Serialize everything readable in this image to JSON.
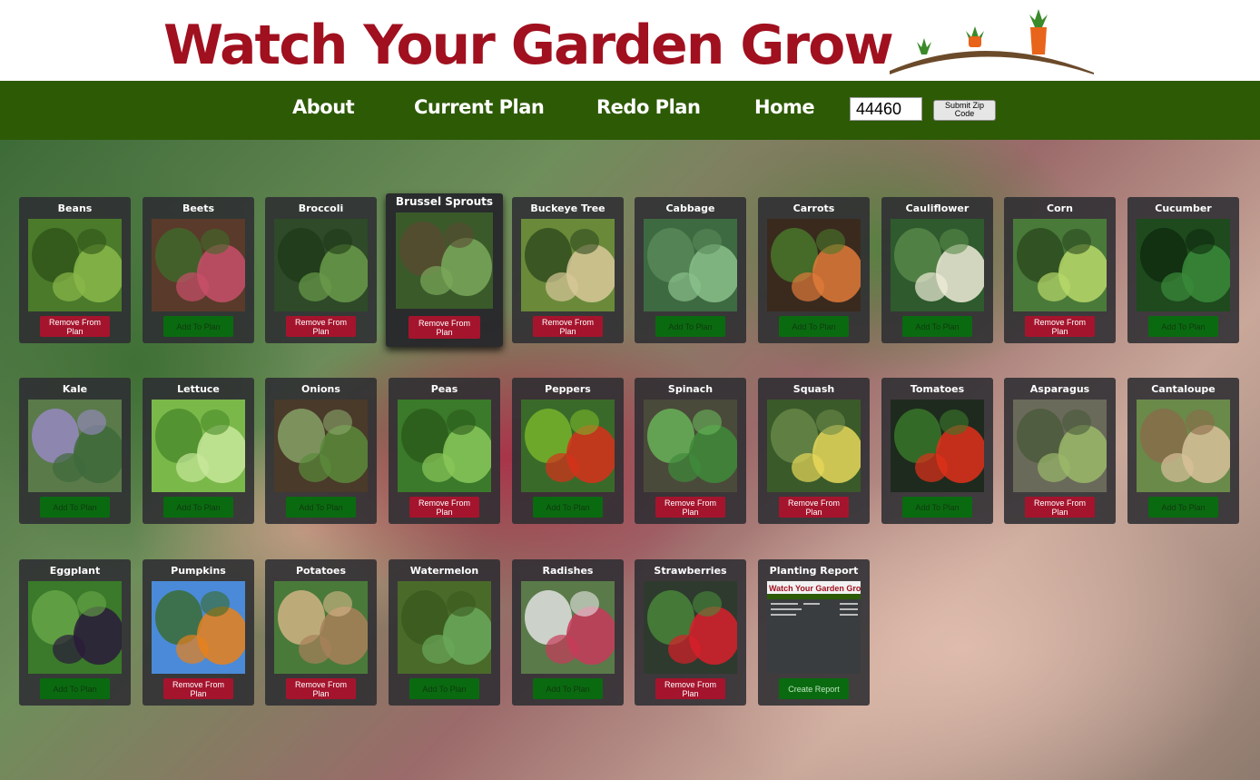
{
  "header": {
    "logo_text": "Watch Your Garden Grow"
  },
  "nav": {
    "links": [
      "About",
      "Current Plan",
      "Redo Plan",
      "Home"
    ],
    "zip_value": "44460",
    "zip_button": "Submit Zip Code"
  },
  "colors": {
    "brand_red": "#a0101f",
    "nav_green": "#2d5a05",
    "add_green": "#0a6a10",
    "remove_red": "#a5142d"
  },
  "cards": [
    {
      "name": "Beans",
      "button": "Remove From Plan",
      "state": "remove"
    },
    {
      "name": "Beets",
      "button": "Add To Plan",
      "state": "add"
    },
    {
      "name": "Broccoli",
      "button": "Remove From Plan",
      "state": "remove"
    },
    {
      "name": "Brussel Sprouts",
      "button": "Remove From Plan",
      "state": "remove"
    },
    {
      "name": "Buckeye Tree",
      "button": "Remove From Plan",
      "state": "remove"
    },
    {
      "name": "Cabbage",
      "button": "Add To Plan",
      "state": "add"
    },
    {
      "name": "Carrots",
      "button": "Add To Plan",
      "state": "add"
    },
    {
      "name": "Cauliflower",
      "button": "Add To Plan",
      "state": "add"
    },
    {
      "name": "Corn",
      "button": "Remove From Plan",
      "state": "remove"
    },
    {
      "name": "Cucumber",
      "button": "Add To Plan",
      "state": "add"
    },
    {
      "name": "Kale",
      "button": "Add To Plan",
      "state": "add"
    },
    {
      "name": "Lettuce",
      "button": "Add To Plan",
      "state": "add"
    },
    {
      "name": "Onions",
      "button": "Add To Plan",
      "state": "add"
    },
    {
      "name": "Peas",
      "button": "Remove From Plan",
      "state": "remove"
    },
    {
      "name": "Peppers",
      "button": "Add To Plan",
      "state": "add"
    },
    {
      "name": "Spinach",
      "button": "Remove From Plan",
      "state": "remove"
    },
    {
      "name": "Squash",
      "button": "Remove From Plan",
      "state": "remove"
    },
    {
      "name": "Tomatoes",
      "button": "Add To Plan",
      "state": "add"
    },
    {
      "name": "Asparagus",
      "button": "Remove From Plan",
      "state": "remove"
    },
    {
      "name": "Cantaloupe",
      "button": "Add To Plan",
      "state": "add"
    },
    {
      "name": "Eggplant",
      "button": "Add To Plan",
      "state": "add"
    },
    {
      "name": "Pumpkins",
      "button": "Remove From Plan",
      "state": "remove"
    },
    {
      "name": "Potatoes",
      "button": "Remove From Plan",
      "state": "remove"
    },
    {
      "name": "Watermelon",
      "button": "Add To Plan",
      "state": "add"
    },
    {
      "name": "Radishes",
      "button": "Add To Plan",
      "state": "add"
    },
    {
      "name": "Strawberries",
      "button": "Remove From Plan",
      "state": "remove"
    },
    {
      "name": "Planting Report",
      "button": "Create Report",
      "state": "report",
      "preview_title": "Watch Your Garden Grow"
    }
  ]
}
